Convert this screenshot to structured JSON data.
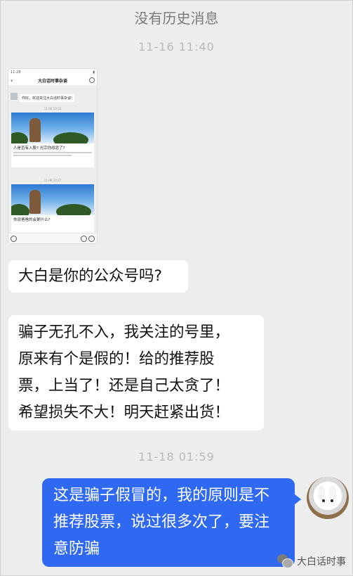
{
  "header": {
    "no_history": "没有历史消息"
  },
  "timestamps": {
    "first": "11-16 11:40",
    "second": "11-18 01:59"
  },
  "screenshot_thumbnail": {
    "status_time": "11:28",
    "title": "大白话时事杂谈",
    "greeting": "你好，欢迎关注大白话时事杂谈!",
    "time_1": "11-04 10:13",
    "card_1_title": "人是否有入股? 光宗你战念了?",
    "time_2": "11-08 10:27",
    "card_2_title": "你说爸爸的会更什么?"
  },
  "messages": [
    {
      "side": "in",
      "text": "大白是你的公众号吗?"
    },
    {
      "side": "in",
      "lines": [
        "骗子无孔不入，我关注的号里，",
        "原来有个是假的！给的推荐股",
        "票，上当了！还是自己太贪了！",
        "希望损失不大！明天赶紧出货！"
      ]
    },
    {
      "side": "out",
      "lines": [
        "这是骗子假冒的，我的原则是不",
        "推荐股票，说过很多次了，要注",
        "意防骗"
      ]
    }
  ],
  "watermark": {
    "text": "大白话时事",
    "icon": "wechat-icon"
  },
  "colors": {
    "background": "#ededed",
    "outgoing_bubble": "#2f69f2",
    "incoming_bubble": "#ffffff",
    "timestamp": "#b9b9b9"
  }
}
